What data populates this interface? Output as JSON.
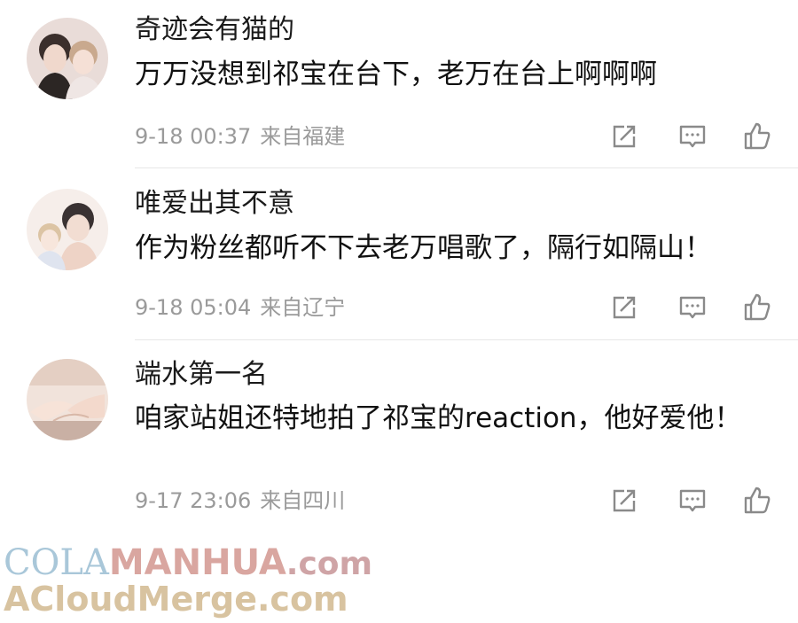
{
  "comments": [
    {
      "username": "奇迹会有猫的",
      "text": "万万没想到祁宝在台下，老万在台上啊啊啊",
      "time": "9-18 00:37",
      "location": "来自福建",
      "avatar_icon": "avatar-two-men-illustration"
    },
    {
      "username": "唯爱出其不意",
      "text": "作为粉丝都听不下去老万唱歌了，隔行如隔山！",
      "time": "9-18 05:04",
      "location": "来自辽宁",
      "avatar_icon": "avatar-two-men-illustration"
    },
    {
      "username": "端水第一名",
      "text": "咱家站姐还特地拍了祁宝的reaction，他好爱他！",
      "time": "9-17 23:06",
      "location": "来自四川",
      "avatar_icon": "avatar-holding-hands-illustration"
    }
  ],
  "actions": {
    "share_icon": "share-icon",
    "comment_icon": "comment-icon",
    "like_icon": "thumbs-up-icon"
  },
  "watermark": {
    "line1_part1": "COLA",
    "line1_part2": "MANHUA",
    "line1_part3": ".com",
    "line2": "ACloudMerge.com"
  },
  "colors": {
    "meta_text": "#9a9a9a",
    "icon": "#8a8a8a",
    "divider": "#e6e6e6"
  }
}
